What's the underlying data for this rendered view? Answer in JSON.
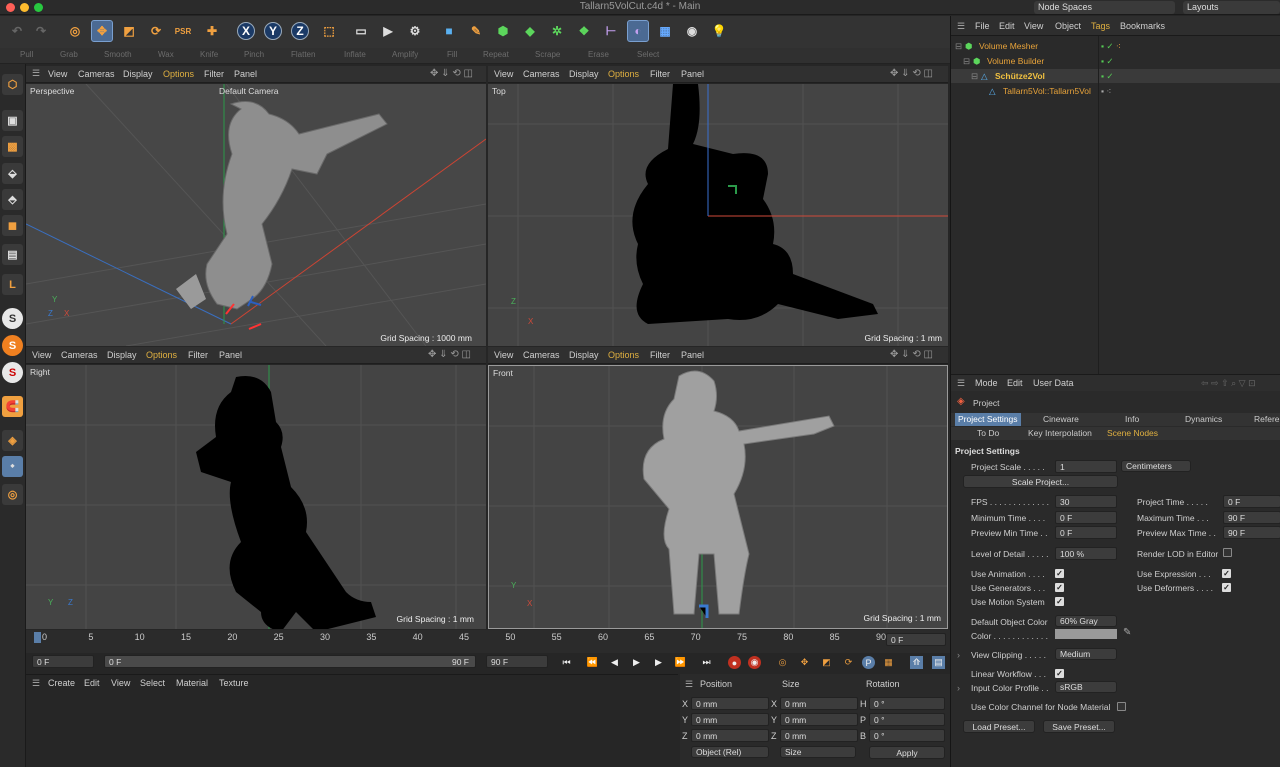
{
  "window": {
    "title": "Tallarn5VolCut.c4d * - Main",
    "node_spaces": "Node Spaces",
    "layouts": "Layouts"
  },
  "sculpt_tools": [
    "Pull",
    "Grab",
    "Smooth",
    "Wax",
    "Knife",
    "Pinch",
    "Flatten",
    "Inflate",
    "Amplify",
    "Fill",
    "Repeat",
    "Scrape",
    "Erase",
    "Select"
  ],
  "toolbar": {
    "x": "X",
    "y": "Y",
    "z": "Z"
  },
  "left_tools": [
    "S",
    "S",
    "S"
  ],
  "viewport_menu": {
    "view": "View",
    "cameras": "Cameras",
    "display": "Display",
    "options": "Options",
    "filter": "Filter",
    "panel": "Panel"
  },
  "viewports": {
    "perspective": {
      "name": "Perspective",
      "camera": "Default Camera",
      "grid": "Grid Spacing : 1000 mm"
    },
    "top": {
      "name": "Top",
      "grid": "Grid Spacing : 1 mm"
    },
    "right": {
      "name": "Right",
      "grid": "Grid Spacing : 1 mm"
    },
    "front": {
      "name": "Front",
      "grid": "Grid Spacing : 1 mm"
    }
  },
  "timeline": {
    "ticks": [
      "0",
      "5",
      "10",
      "15",
      "20",
      "25",
      "30",
      "35",
      "40",
      "45",
      "50",
      "55",
      "60",
      "65",
      "70",
      "75",
      "80",
      "85",
      "90"
    ],
    "current": "0 F",
    "start": "0 F",
    "range_start": "0 F",
    "range_end": "90 F",
    "end": "90 F"
  },
  "material_menu": [
    "Create",
    "Edit",
    "View",
    "Select",
    "Material",
    "Texture"
  ],
  "coords": {
    "headers": [
      "Position",
      "Size",
      "Rotation"
    ],
    "rows": [
      {
        "a": "X",
        "pos": "0 mm",
        "b": "X",
        "size": "0 mm",
        "c": "H",
        "rot": "0 °"
      },
      {
        "a": "Y",
        "pos": "0 mm",
        "b": "Y",
        "size": "0 mm",
        "c": "P",
        "rot": "0 °"
      },
      {
        "a": "Z",
        "pos": "0 mm",
        "b": "Z",
        "size": "0 mm",
        "c": "B",
        "rot": "0 °"
      }
    ],
    "mode": "Object (Rel)",
    "size_mode": "Size",
    "apply": "Apply"
  },
  "object_manager": {
    "menu": [
      "File",
      "Edit",
      "View",
      "Object",
      "Tags",
      "Bookmarks"
    ],
    "objects": [
      {
        "name": "Volume Mesher",
        "color": "#e8a33a"
      },
      {
        "name": "Volume Builder",
        "color": "#e8a33a"
      },
      {
        "name": "Schütze2Vol",
        "color": "#f0c040"
      },
      {
        "name": "Tallarn5Vol::Tallarn5Vol",
        "color": "#e8a33a"
      }
    ]
  },
  "attributes": {
    "menu": [
      "Mode",
      "Edit",
      "User Data"
    ],
    "object": "Project",
    "tabs1": [
      "Project Settings",
      "Cineware",
      "Info",
      "Dynamics",
      "Referen"
    ],
    "tabs2": [
      "To Do",
      "Key Interpolation",
      "Scene Nodes"
    ],
    "section": "Project Settings",
    "project_scale_label": "Project Scale . . . . .",
    "project_scale": "1",
    "unit": "Centimeters",
    "scale_button": "Scale Project...",
    "fps_label": "FPS . . . . . . . . . . . . .",
    "fps": "30",
    "project_time_label": "Project Time . . . . .",
    "project_time": "0 F",
    "min_time_label": "Minimum Time . . . .",
    "min_time": "0 F",
    "max_time_label": "Maximum Time . . .",
    "max_time": "90 F",
    "prev_min_label": "Preview Min Time . .",
    "prev_min": "0 F",
    "prev_max_label": "Preview Max Time . .",
    "prev_max": "90 F",
    "lod_label": "Level of Detail . . . . .",
    "lod": "100 %",
    "render_lod": "Render LOD in Editor",
    "use_animation": "Use Animation . . . .",
    "use_expression": "Use Expression . . .",
    "use_generators": "Use Generators . . .",
    "use_deformers": "Use Deformers . . . .",
    "use_motion": "Use Motion System",
    "default_color_label": "Default Object Color",
    "default_color": "60% Gray",
    "color_label": "Color . . . . . . . . . . . .",
    "view_clipping_label": "View Clipping . . . . .",
    "view_clipping": "Medium",
    "linear_workflow": "Linear Workflow . . .",
    "input_profile_label": "Input Color Profile . .",
    "input_profile": "sRGB",
    "node_material": "Use Color Channel for Node Material",
    "load_preset": "Load Preset...",
    "save_preset": "Save Preset..."
  }
}
